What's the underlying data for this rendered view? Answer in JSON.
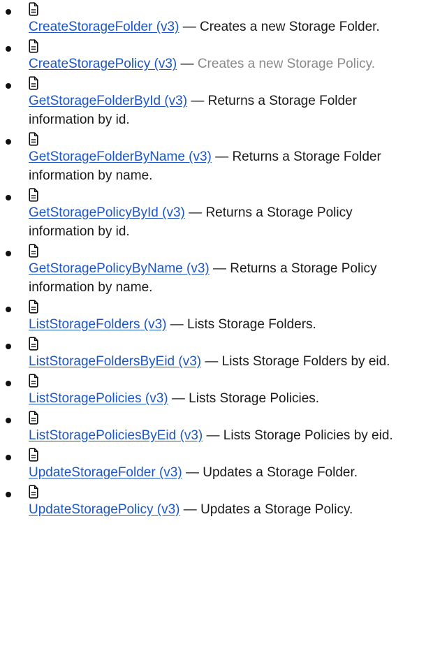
{
  "items": [
    {
      "name": "CreateStorageFolder (v3)",
      "sep": "—",
      "desc": "Creates a new Storage Folder.",
      "muted": false,
      "icon": "document-icon"
    },
    {
      "name": "CreateStoragePolicy (v3)",
      "sep": "—",
      "desc": "Creates a new Storage Policy.",
      "muted": true,
      "icon": "document-icon"
    },
    {
      "name": "GetStorageFolderById (v3)",
      "sep": "—",
      "desc": "Returns a Storage Folder information by id.",
      "muted": false,
      "icon": "document-icon"
    },
    {
      "name": "GetStorageFolderByName (v3)",
      "sep": "—",
      "desc": "Returns a Storage Folder information by name.",
      "muted": false,
      "icon": "document-icon"
    },
    {
      "name": "GetStoragePolicyById (v3)",
      "sep": "—",
      "desc": "Returns a Storage Policy information by id.",
      "muted": false,
      "icon": "document-icon"
    },
    {
      "name": "GetStoragePolicyByName (v3)",
      "sep": "—",
      "desc": "Returns a Storage Policy information by name.",
      "muted": false,
      "icon": "document-icon"
    },
    {
      "name": "ListStorageFolders (v3)",
      "sep": "—",
      "desc": "Lists Storage Folders.",
      "muted": false,
      "icon": "document-icon"
    },
    {
      "name": "ListStorageFoldersByEid (v3)",
      "sep": "—",
      "desc": "Lists Storage Folders by eid.",
      "muted": false,
      "icon": "document-icon"
    },
    {
      "name": "ListStoragePolicies (v3)",
      "sep": "—",
      "desc": "Lists Storage Policies.",
      "muted": false,
      "icon": "document-icon"
    },
    {
      "name": "ListStoragePoliciesByEid (v3)",
      "sep": "—",
      "desc": "Lists Storage Policies by eid.",
      "muted": false,
      "icon": "document-icon"
    },
    {
      "name": "UpdateStorageFolder (v3)",
      "sep": "—",
      "desc": "Updates a Storage Folder.",
      "muted": false,
      "icon": "document-icon"
    },
    {
      "name": "UpdateStoragePolicy (v3)",
      "sep": "—",
      "desc": "Updates a Storage Policy.",
      "muted": false,
      "icon": "document-icon"
    }
  ],
  "colors": {
    "link": "#1a56c8",
    "text": "#1a1a1a",
    "muted": "#8a8a8a"
  }
}
